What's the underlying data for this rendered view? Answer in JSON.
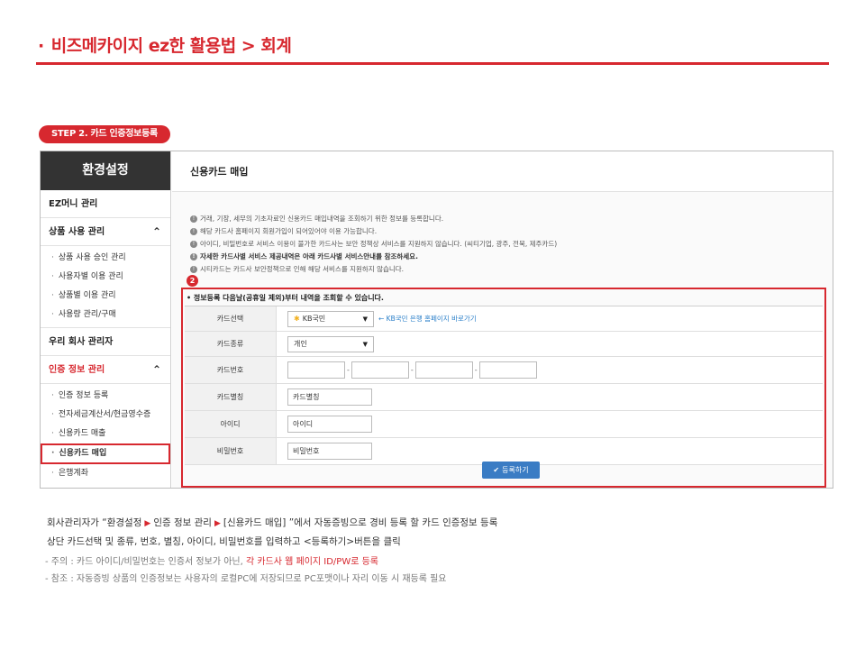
{
  "header": {
    "bullet": "·",
    "title": "비즈메카이지 ez한 활용법 > 회계"
  },
  "step_badge": "STEP 2.  카드 인증정보등록",
  "sidebar": {
    "title": "환경설정",
    "menu_ez_money": "EZ머니 관리",
    "menu_product": "상품 사용 관리",
    "product_items": [
      "상품 사용 승인 관리",
      "사용자별 이용 관리",
      "상품별 이용 관리",
      "사용량 관리/구매"
    ],
    "menu_admin": "우리 회사 관리자",
    "menu_auth": "인증 정보 관리",
    "auth_items": [
      "인증 정보 등록",
      "전자세금계산서/현금영수증",
      "신용카드 매출",
      "신용카드 매입",
      "은행계좌"
    ],
    "chevron": "⌃"
  },
  "main": {
    "title": "신용카드 매입",
    "notices": [
      "거래, 기장, 세무의 기초자료인 신용카드 매입내역을 조회하기 위한 정보를 등록합니다.",
      "해당 카드사 홈페이지 회원가입이 되어있어야 이용 가능합니다.",
      "아이디, 비밀번호로 서비스 이용이 불가한 카드사는 보안 정책상 서비스를 지원하지 않습니다. (씨티기업, 광주, 전북, 제주카드)",
      "자세한 카드사별 서비스 제공내역은 아래 카드사별 서비스안내를 참조하세요.",
      "시티카드는 카드사 보안정책으로 인해 해당 서비스를 지원하지 않습니다."
    ],
    "notice_icon": "!"
  },
  "form": {
    "step_number": "2",
    "lead": "• 정보등록 다음날(공휴일 제외)부터 내역을 조회할 수 있습니다.",
    "labels": {
      "card_select": "카드선택",
      "card_type": "카드종류",
      "card_number": "카드번호",
      "card_alias": "카드별칭",
      "user_id": "아이디",
      "password": "비밀번호"
    },
    "card_select_value": "KB국민",
    "kb_mark": "✱",
    "bank_link": "← KB국민 은행 홈페이지 바로가기",
    "card_type_value": "개인",
    "card_number_dash": "-",
    "card_alias_value": "카드별칭",
    "user_id_value": "아이디",
    "password_value": "비밀번호",
    "submit_label": "등록하기",
    "submit_icon": "✔",
    "caret": "▼"
  },
  "description": {
    "line1_a": "회사관리자가 “환경설정",
    "line1_b": "인증 정보 관리",
    "line1_c": "[신용카드 매입] ”에서 자동증빙으로 경비 등록 할 카드 인증정보 등록",
    "arrow": "▶",
    "line2": "상단 카드선택 및 종류, 번호, 별칭, 아이디, 비밀번호를 입력하고 <등록하기>버튼을 클릭"
  },
  "notes": {
    "note1_a": "- 주의 : 카드 아이디/비밀번호는 인증서 정보가  아닌, ",
    "note1_b": "각 카드사 웹 페이지 ID/PW로 등록",
    "note2": "- 참조 : 자동증빙 상품의 인증정보는 사용자의 로컬PC에 저장되므로 PC포맷이나 자리 이동 시 재등록 필요"
  },
  "colors": {
    "accent": "#d7282f",
    "sidebar_head": "#333333",
    "button": "#3a7cc4",
    "link": "#2a7fc9"
  }
}
